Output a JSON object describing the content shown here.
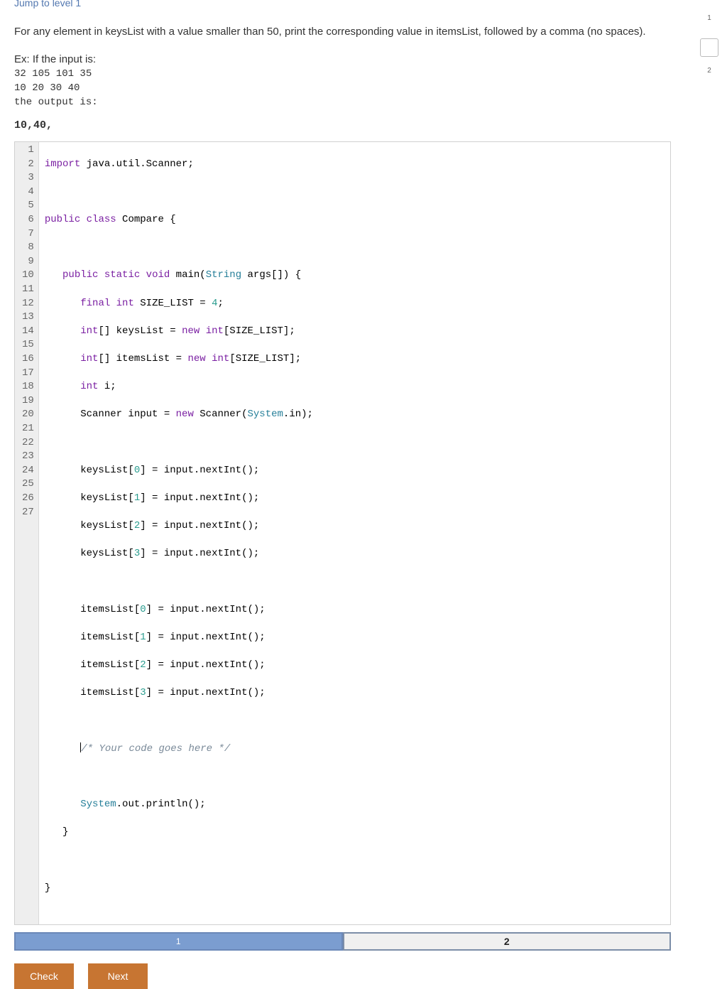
{
  "jump_link": "Jump to level 1",
  "problem_statement": "For any element in keysList with a value smaller than 50, print the corresponding value in itemsList, followed by a comma (no spaces).",
  "example_intro": "Ex: If the input is:",
  "input_lines": [
    "32 105 101 35",
    "10 20 30 40"
  ],
  "output_label": "the output is:",
  "output_value": "10,40,",
  "code": {
    "line_count": 27,
    "tokens": {
      "l1_import": "import",
      "l1_rest": " java.util.Scanner;",
      "l3_public": "public",
      "l3_class": " class",
      "l3_rest": " Compare {",
      "l5_a": "   ",
      "l5_public": "public",
      "l5_static": " static",
      "l5_void": " void",
      "l5_main": " main(",
      "l5_string": "String",
      "l5_rest": " args[]) {",
      "l6_a": "      ",
      "l6_final": "final",
      "l6_int": " int",
      "l6_rest": " SIZE_LIST = ",
      "l6_num": "4",
      "l6_semi": ";",
      "l7_a": "      ",
      "l7_int": "int",
      "l7_b": "[] keysList = ",
      "l7_new": "new",
      "l7_int2": " int",
      "l7_rest": "[SIZE_LIST];",
      "l8_a": "      ",
      "l8_int": "int",
      "l8_b": "[] itemsList = ",
      "l8_new": "new",
      "l8_int2": " int",
      "l8_rest": "[SIZE_LIST];",
      "l9_a": "      ",
      "l9_int": "int",
      "l9_rest": " i;",
      "l10_a": "      Scanner input = ",
      "l10_new": "new",
      "l10_b": " Scanner(",
      "l10_sys": "System",
      "l10_rest": ".in);",
      "l12_a": "      keysList[",
      "l12_n": "0",
      "l12_b": "] = input.nextInt();",
      "l13_a": "      keysList[",
      "l13_n": "1",
      "l13_b": "] = input.nextInt();",
      "l14_a": "      keysList[",
      "l14_n": "2",
      "l14_b": "] = input.nextInt();",
      "l15_a": "      keysList[",
      "l15_n": "3",
      "l15_b": "] = input.nextInt();",
      "l17_a": "      itemsList[",
      "l17_n": "0",
      "l17_b": "] = input.nextInt();",
      "l18_a": "      itemsList[",
      "l18_n": "1",
      "l18_b": "] = input.nextInt();",
      "l19_a": "      itemsList[",
      "l19_n": "2",
      "l19_b": "] = input.nextInt();",
      "l20_a": "      itemsList[",
      "l20_n": "3",
      "l20_b": "] = input.nextInt();",
      "l22_a": "      ",
      "l22_cmnt": "/* Your code goes here */",
      "l24_a": "      ",
      "l24_sys": "System",
      "l24_b": ".out.println();",
      "l25": "   }",
      "l27": "}"
    }
  },
  "levels": {
    "active": "1",
    "inactive": "2"
  },
  "buttons": {
    "check": "Check",
    "next": "Next"
  },
  "rail": {
    "p1": "1",
    "p2": "2"
  }
}
